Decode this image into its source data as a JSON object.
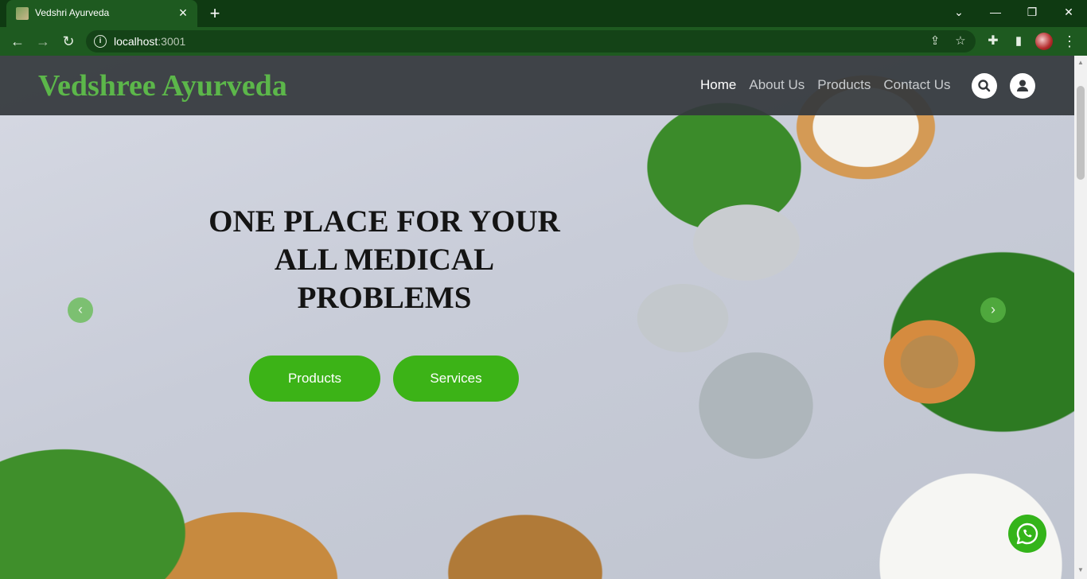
{
  "browser": {
    "tab_title": "Vedshri Ayurveda",
    "url_host": "localhost",
    "url_port": ":3001"
  },
  "site": {
    "brand": "Vedshree Ayurveda",
    "nav": [
      {
        "label": "Home",
        "active": true
      },
      {
        "label": "About Us",
        "active": false
      },
      {
        "label": "Products",
        "active": false
      },
      {
        "label": "Contact Us",
        "active": false
      }
    ]
  },
  "hero": {
    "headline": "ONE PLACE FOR YOUR ALL MEDICAL PROBLEMS",
    "buttons": {
      "primary": "Products",
      "secondary": "Services"
    }
  },
  "colors": {
    "browser_chrome": "#1e5a20",
    "brand_green": "#5cb74a",
    "cta_green": "#3cb317",
    "navbar": "#34383c"
  },
  "icons": [
    "search-icon",
    "user-icon",
    "whatsapp-icon",
    "chevron-left-icon",
    "chevron-right-icon"
  ]
}
